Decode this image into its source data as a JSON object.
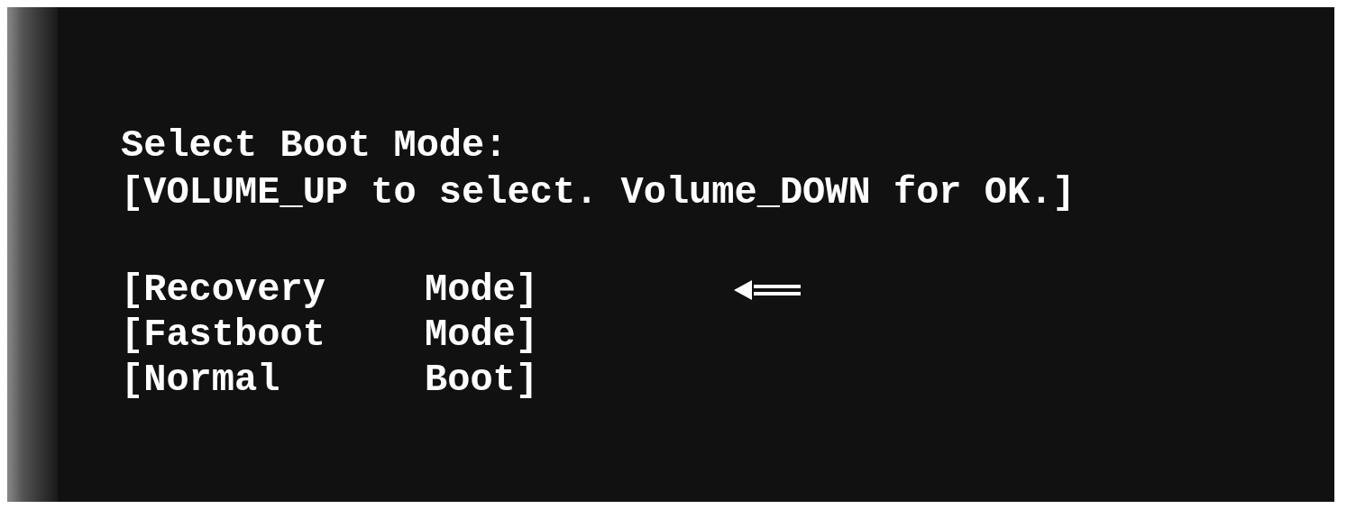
{
  "screen": {
    "title": "Select Boot Mode:",
    "instructions": "[VOLUME_UP to select. Volume_DOWN for OK.]"
  },
  "menu": [
    {
      "label": "[Recovery",
      "mode": "Mode]",
      "selected": true
    },
    {
      "label": "[Fastboot",
      "mode": "Mode]",
      "selected": false
    },
    {
      "label": "[Normal",
      "mode": "Boot]",
      "selected": false
    }
  ]
}
